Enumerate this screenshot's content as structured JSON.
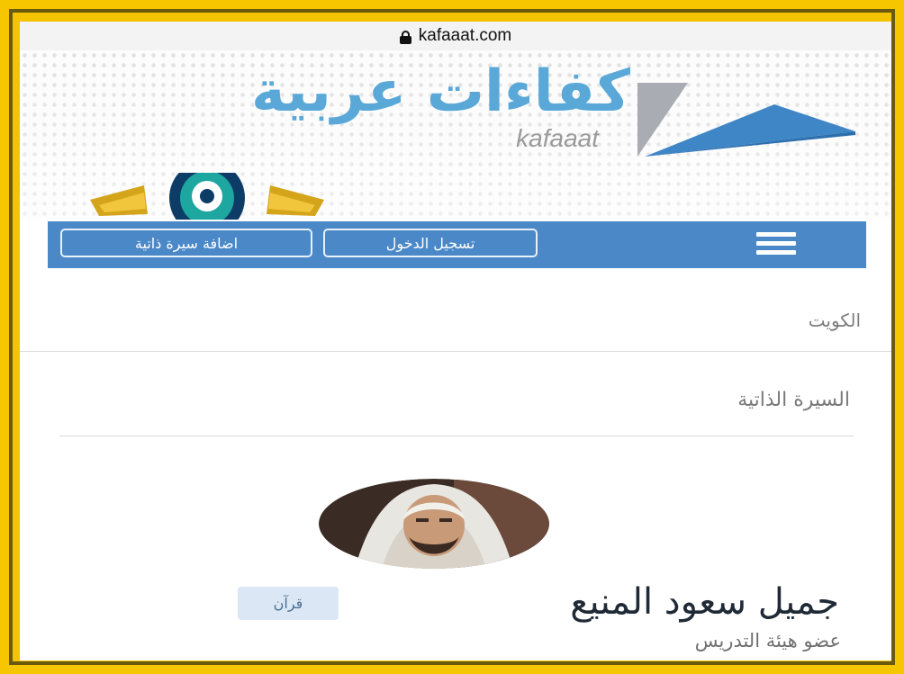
{
  "browser": {
    "url": "kafaaat.com"
  },
  "brand": {
    "name_ar": "كفاءات عربية",
    "name_en": "kafaaat"
  },
  "nav": {
    "menu_icon": "hamburger-icon",
    "login_label": "تسجيل الدخول",
    "add_cv_label": "اضافة سيرة ذاتية"
  },
  "location": {
    "country": "الكويت"
  },
  "section": {
    "title": "السيرة الذاتية"
  },
  "profile": {
    "name": "جميل سعود المنيع",
    "tag": "قرآن",
    "job_title": "عضو هيئة التدريس"
  },
  "colors": {
    "frame": "#f6c600",
    "nav": "#4a88c8",
    "brand_text": "#5aa8d8",
    "tag_bg": "#dbe7f4"
  }
}
